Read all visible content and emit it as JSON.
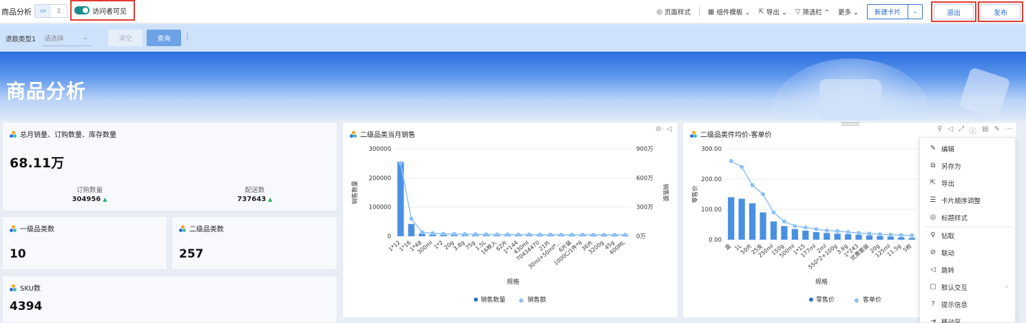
{
  "header": {
    "title": "商品分析",
    "visibility_label": "访问者可见",
    "tools": [
      {
        "icon": "palette-icon",
        "label": "页面样式"
      },
      {
        "icon": "template-icon",
        "label": "组件模板 ⌄"
      },
      {
        "icon": "export-icon",
        "label": "导出 ⌄"
      },
      {
        "icon": "filter-icon",
        "label": "筛选栏 ⌃"
      },
      {
        "icon": "",
        "label": "更多 ⌄"
      }
    ],
    "new_card_label": "新建卡片",
    "exit_label": "退出",
    "publish_label": "发布"
  },
  "filter": {
    "label": "退款类型1",
    "placeholder": "请选择",
    "clear_label": "清空",
    "query_label": "查询"
  },
  "banner": {
    "title": "商品分析"
  },
  "kpi_main": {
    "title": "总月销量、订购数量、库存数量",
    "value": "68.11万",
    "sub1_label": "订购数量",
    "sub1_value": "304956",
    "sub2_label": "配送数",
    "sub2_value": "737643"
  },
  "kpi_level1": {
    "title": "一级品类数",
    "value": "10"
  },
  "kpi_level2": {
    "title": "二级品类数",
    "value": "257"
  },
  "kpi_sku": {
    "title": "SKU数",
    "value": "4394"
  },
  "chart_data": [
    {
      "type": "bar",
      "title": "二级品类当月销售",
      "xlabel": "规格",
      "ylabel": "销售数量",
      "y2label": "销售额",
      "ylim": [
        0,
        300000
      ],
      "y2lim": [
        0,
        9000000
      ],
      "yticks": [
        "300000",
        "200000",
        "100000",
        "0"
      ],
      "y2ticks": [
        "900万",
        "600万",
        "300万",
        "0万"
      ],
      "categories": [
        "1*12",
        "1*16",
        "1*48",
        "300ml",
        "1*2",
        "20g",
        "3.8g",
        "75g",
        "1.5L",
        "16枚入",
        "62片",
        "1*144",
        "430ml",
        "70434470",
        "21片",
        "30ml+50ml*...",
        "6片装",
        "1000C/1件*6",
        "36片",
        "3200g",
        "45g",
        "400ML"
      ],
      "series": [
        {
          "name": "销售数量",
          "values": [
            255000,
            42000,
            9000,
            6000,
            5000,
            4500,
            4000,
            3800,
            3500,
            3300,
            3200,
            3000,
            3000,
            2900,
            2800,
            2700,
            2700,
            2600,
            2600,
            2500,
            2500,
            2400
          ]
        },
        {
          "name": "销售额",
          "values": [
            7500000,
            1800000,
            420000,
            300000,
            250000,
            230000,
            210000,
            200000,
            190000,
            180000,
            175000,
            170000,
            165000,
            160000,
            158000,
            155000,
            150000,
            148000,
            145000,
            143000,
            140000,
            140000
          ]
        }
      ],
      "legend": "bottom"
    },
    {
      "type": "bar",
      "title": "二级品类件均价-客单价",
      "xlabel": "规格",
      "ylabel": "零售价",
      "ylim": [
        0,
        300
      ],
      "yticks": [
        "300.00",
        "200.00",
        "100.00",
        "0.00"
      ],
      "categories": [
        "盒",
        "1L",
        "50片",
        "25支",
        "250ml",
        "150g",
        "500ml",
        "1*15",
        "177ml",
        "2ml",
        "550*2+100g",
        "3.6g",
        "1*243",
        "优惠套装",
        "20g",
        "125ml",
        "11.5g",
        "5枚"
      ],
      "series": [
        {
          "name": "零售价",
          "values": [
            140,
            135,
            120,
            90,
            60,
            45,
            35,
            30,
            25,
            22,
            20,
            18,
            16,
            14,
            12,
            10,
            8,
            6
          ]
        },
        {
          "name": "客单价",
          "values": [
            260,
            240,
            180,
            150,
            90,
            60,
            45,
            40,
            35,
            30,
            28,
            25,
            22,
            20,
            18,
            16,
            15,
            14
          ]
        }
      ],
      "legend": "bottom"
    }
  ],
  "menu": {
    "items": [
      {
        "icon": "edit-icon",
        "label": "编辑"
      },
      {
        "icon": "save-as-icon",
        "label": "另存为"
      },
      {
        "icon": "export-icon",
        "label": "导出"
      },
      {
        "icon": "sort-icon",
        "label": "卡片顺序调整"
      },
      {
        "icon": "palette-icon",
        "label": "标题样式"
      },
      {
        "icon": "drill-icon",
        "label": "钻取"
      },
      {
        "icon": "link-icon",
        "label": "联动"
      },
      {
        "icon": "jump-icon",
        "label": "跳转"
      },
      {
        "icon": "interact-icon",
        "label": "默认交互"
      },
      {
        "icon": "help-icon",
        "label": "提示信息"
      },
      {
        "icon": "move-icon",
        "label": "移动至"
      }
    ]
  },
  "colors": {
    "primary": "#2f6fd3",
    "bar": "#4a90e2",
    "line": "#8dc0f5",
    "highlight": "#e03a2f",
    "toggle": "#1a8c8c"
  }
}
